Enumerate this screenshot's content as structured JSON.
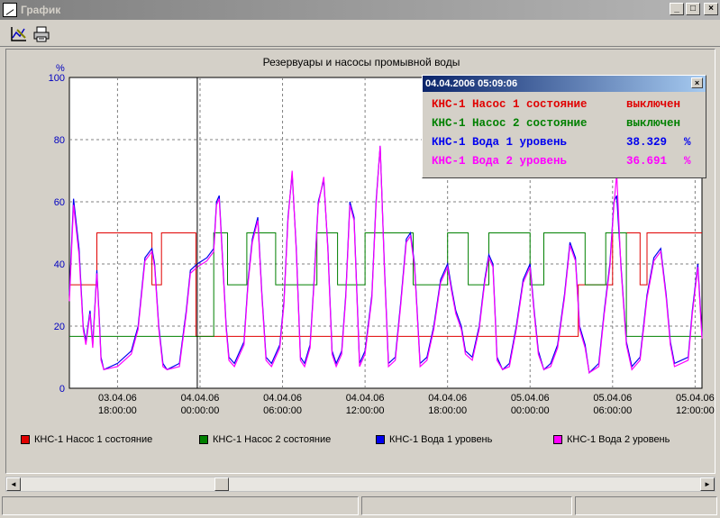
{
  "window": {
    "title": "График",
    "min": "_",
    "max": "□",
    "close": "×"
  },
  "toolbar": {
    "tools": [
      {
        "icon": "chart-tool-icon"
      },
      {
        "icon": "printer-icon"
      }
    ]
  },
  "chart_data": {
    "type": "line",
    "title": "Резервуары и насосы промывной воды",
    "ylabel": "%",
    "ylim": [
      0,
      100
    ],
    "yticks": [
      "0",
      "20",
      "40",
      "60",
      "80",
      "100"
    ],
    "xticks": [
      {
        "date": "03.04.06",
        "time": "18:00:00"
      },
      {
        "date": "04.04.06",
        "time": "00:00:00"
      },
      {
        "date": "04.04.06",
        "time": "06:00:00"
      },
      {
        "date": "04.04.06",
        "time": "12:00:00"
      },
      {
        "date": "04.04.06",
        "time": "18:00:00"
      },
      {
        "date": "05.04.06",
        "time": "00:00:00"
      },
      {
        "date": "05.04.06",
        "time": "06:00:00"
      },
      {
        "date": "05.04.06",
        "time": "12:00:00"
      }
    ],
    "xlim_hours": [
      -3.5,
      42.5
    ],
    "cursor_hour": 5.8,
    "grid": true,
    "series": [
      {
        "name": "КНС-1 Насос 1 состояние",
        "color": "#e00000",
        "step": true,
        "points": [
          [
            -3.5,
            33.3
          ],
          [
            -1.5,
            33.3
          ],
          [
            -1.5,
            50
          ],
          [
            2.5,
            50
          ],
          [
            2.5,
            33.3
          ],
          [
            3.2,
            33.3
          ],
          [
            3.2,
            50
          ],
          [
            5.7,
            50
          ],
          [
            5.7,
            16.7
          ],
          [
            7,
            16.7
          ],
          [
            7,
            16.7
          ],
          [
            33.5,
            16.7
          ],
          [
            33.5,
            33.3
          ],
          [
            36,
            33.3
          ],
          [
            36,
            50
          ],
          [
            38,
            50
          ],
          [
            38,
            33.3
          ],
          [
            38.5,
            33.3
          ],
          [
            38.5,
            50
          ],
          [
            42.5,
            50
          ]
        ]
      },
      {
        "name": "КНС-1 Насос 2 состояние",
        "color": "#008000",
        "step": true,
        "points": [
          [
            -3.5,
            16.7
          ],
          [
            7,
            16.7
          ],
          [
            7,
            50
          ],
          [
            8,
            50
          ],
          [
            8,
            33.3
          ],
          [
            9.4,
            33.3
          ],
          [
            9.4,
            50
          ],
          [
            11.5,
            50
          ],
          [
            11.5,
            33.3
          ],
          [
            14.5,
            33.3
          ],
          [
            14.5,
            50
          ],
          [
            16,
            50
          ],
          [
            16,
            33.3
          ],
          [
            18,
            33.3
          ],
          [
            18,
            50
          ],
          [
            21.5,
            50
          ],
          [
            21.5,
            33.3
          ],
          [
            24,
            33.3
          ],
          [
            24,
            50
          ],
          [
            25.5,
            50
          ],
          [
            25.5,
            33.3
          ],
          [
            27,
            33.3
          ],
          [
            27,
            50
          ],
          [
            30,
            50
          ],
          [
            30,
            33.3
          ],
          [
            31,
            33.3
          ],
          [
            31,
            50
          ],
          [
            34,
            50
          ],
          [
            34,
            33.3
          ],
          [
            35.5,
            33.3
          ],
          [
            35.5,
            50
          ],
          [
            37,
            50
          ],
          [
            37,
            16.7
          ],
          [
            42.5,
            16.7
          ]
        ]
      },
      {
        "name": "КНС-1 Вода 1 уровень",
        "color": "#0000ee",
        "points": [
          [
            -3.5,
            30
          ],
          [
            -3.2,
            61
          ],
          [
            -2.8,
            45
          ],
          [
            -2.5,
            20
          ],
          [
            -2.3,
            15
          ],
          [
            -2.0,
            25
          ],
          [
            -1.8,
            14
          ],
          [
            -1.6,
            30
          ],
          [
            -1.5,
            38
          ],
          [
            -1.3,
            20
          ],
          [
            -1.2,
            10
          ],
          [
            -1.0,
            6
          ],
          [
            0,
            8
          ],
          [
            1,
            12
          ],
          [
            1.5,
            20
          ],
          [
            2,
            42
          ],
          [
            2.5,
            45
          ],
          [
            2.7,
            40
          ],
          [
            3.0,
            20
          ],
          [
            3.3,
            8
          ],
          [
            3.6,
            6
          ],
          [
            4.5,
            8
          ],
          [
            5.0,
            25
          ],
          [
            5.3,
            38
          ],
          [
            5.8,
            40
          ],
          [
            6.5,
            42
          ],
          [
            7,
            45
          ],
          [
            7.2,
            60
          ],
          [
            7.4,
            62
          ],
          [
            7.6,
            45
          ],
          [
            7.9,
            20
          ],
          [
            8.1,
            10
          ],
          [
            8.5,
            8
          ],
          [
            9.2,
            15
          ],
          [
            9.5,
            35
          ],
          [
            9.8,
            48
          ],
          [
            10.2,
            55
          ],
          [
            10.5,
            30
          ],
          [
            10.8,
            10
          ],
          [
            11.2,
            8
          ],
          [
            11.8,
            14
          ],
          [
            12.1,
            28
          ],
          [
            12.4,
            55
          ],
          [
            12.7,
            69
          ],
          [
            13.0,
            45
          ],
          [
            13.3,
            10
          ],
          [
            13.6,
            8
          ],
          [
            14.0,
            14
          ],
          [
            14.3,
            35
          ],
          [
            14.6,
            60
          ],
          [
            15.0,
            67
          ],
          [
            15.3,
            45
          ],
          [
            15.6,
            12
          ],
          [
            15.9,
            8
          ],
          [
            16.3,
            12
          ],
          [
            16.6,
            30
          ],
          [
            16.9,
            60
          ],
          [
            17.2,
            55
          ],
          [
            17.6,
            8
          ],
          [
            18.0,
            12
          ],
          [
            18.5,
            30
          ],
          [
            18.8,
            60
          ],
          [
            19.1,
            78
          ],
          [
            19.4,
            40
          ],
          [
            19.7,
            8
          ],
          [
            20.2,
            10
          ],
          [
            20.6,
            28
          ],
          [
            21.0,
            48
          ],
          [
            21.3,
            50
          ],
          [
            21.6,
            40
          ],
          [
            22.0,
            8
          ],
          [
            22.5,
            10
          ],
          [
            23.0,
            20
          ],
          [
            23.5,
            35
          ],
          [
            24.0,
            40
          ],
          [
            24.3,
            32
          ],
          [
            24.6,
            25
          ],
          [
            25.0,
            20
          ],
          [
            25.3,
            12
          ],
          [
            25.8,
            10
          ],
          [
            26.3,
            20
          ],
          [
            26.7,
            35
          ],
          [
            27.0,
            43
          ],
          [
            27.3,
            40
          ],
          [
            27.6,
            10
          ],
          [
            28.0,
            6
          ],
          [
            28.5,
            8
          ],
          [
            29.0,
            20
          ],
          [
            29.5,
            35
          ],
          [
            30.0,
            40
          ],
          [
            30.3,
            25
          ],
          [
            30.6,
            12
          ],
          [
            31.0,
            6
          ],
          [
            31.5,
            8
          ],
          [
            32,
            14
          ],
          [
            32.5,
            30
          ],
          [
            32.9,
            47
          ],
          [
            33.3,
            42
          ],
          [
            33.6,
            20
          ],
          [
            34.0,
            14
          ],
          [
            34.3,
            5
          ],
          [
            35.0,
            8
          ],
          [
            35.4,
            25
          ],
          [
            35.8,
            40
          ],
          [
            36.1,
            60
          ],
          [
            36.3,
            62
          ],
          [
            36.6,
            40
          ],
          [
            37.0,
            15
          ],
          [
            37.4,
            7
          ],
          [
            38.0,
            10
          ],
          [
            38.5,
            30
          ],
          [
            39.0,
            42
          ],
          [
            39.5,
            45
          ],
          [
            39.9,
            30
          ],
          [
            40.2,
            15
          ],
          [
            40.5,
            8
          ],
          [
            41.5,
            10
          ],
          [
            41.8,
            25
          ],
          [
            42.2,
            40
          ],
          [
            42.5,
            17
          ]
        ]
      },
      {
        "name": "КНС-1 Вода 2 уровень",
        "color": "#ff00ff",
        "points": [
          [
            -3.5,
            28
          ],
          [
            -3.2,
            59
          ],
          [
            -2.8,
            43
          ],
          [
            -2.5,
            19
          ],
          [
            -2.3,
            14
          ],
          [
            -2.0,
            24
          ],
          [
            -1.8,
            13
          ],
          [
            -1.6,
            29
          ],
          [
            -1.5,
            37
          ],
          [
            -1.3,
            19
          ],
          [
            -1.2,
            9
          ],
          [
            -1.0,
            6
          ],
          [
            0,
            7
          ],
          [
            1,
            11
          ],
          [
            1.5,
            19
          ],
          [
            2,
            41
          ],
          [
            2.5,
            44
          ],
          [
            2.7,
            39
          ],
          [
            3.0,
            19
          ],
          [
            3.3,
            7
          ],
          [
            3.6,
            6
          ],
          [
            4.5,
            7
          ],
          [
            5.0,
            24
          ],
          [
            5.3,
            37
          ],
          [
            5.8,
            39
          ],
          [
            6.5,
            41
          ],
          [
            7,
            44
          ],
          [
            7.2,
            59
          ],
          [
            7.4,
            61
          ],
          [
            7.6,
            44
          ],
          [
            7.9,
            19
          ],
          [
            8.1,
            9
          ],
          [
            8.5,
            7
          ],
          [
            9.2,
            14
          ],
          [
            9.5,
            34
          ],
          [
            9.8,
            47
          ],
          [
            10.2,
            54
          ],
          [
            10.5,
            29
          ],
          [
            10.8,
            9
          ],
          [
            11.2,
            7
          ],
          [
            11.8,
            13
          ],
          [
            12.1,
            27
          ],
          [
            12.4,
            54
          ],
          [
            12.7,
            70
          ],
          [
            13.0,
            44
          ],
          [
            13.3,
            9
          ],
          [
            13.6,
            7
          ],
          [
            14.0,
            13
          ],
          [
            14.3,
            34
          ],
          [
            14.6,
            59
          ],
          [
            15.0,
            68
          ],
          [
            15.3,
            44
          ],
          [
            15.6,
            11
          ],
          [
            15.9,
            7
          ],
          [
            16.3,
            11
          ],
          [
            16.6,
            29
          ],
          [
            16.9,
            59
          ],
          [
            17.2,
            54
          ],
          [
            17.6,
            7
          ],
          [
            18.0,
            11
          ],
          [
            18.5,
            29
          ],
          [
            18.8,
            59
          ],
          [
            19.1,
            78
          ],
          [
            19.4,
            39
          ],
          [
            19.7,
            7
          ],
          [
            20.2,
            9
          ],
          [
            20.6,
            27
          ],
          [
            21.0,
            47
          ],
          [
            21.3,
            49
          ],
          [
            21.6,
            39
          ],
          [
            22.0,
            7
          ],
          [
            22.5,
            9
          ],
          [
            23.0,
            19
          ],
          [
            23.5,
            34
          ],
          [
            24.0,
            39
          ],
          [
            24.3,
            31
          ],
          [
            24.6,
            24
          ],
          [
            25.0,
            19
          ],
          [
            25.3,
            11
          ],
          [
            25.8,
            9
          ],
          [
            26.3,
            19
          ],
          [
            26.7,
            34
          ],
          [
            27.0,
            42
          ],
          [
            27.3,
            39
          ],
          [
            27.6,
            9
          ],
          [
            28.0,
            6
          ],
          [
            28.5,
            7
          ],
          [
            29.0,
            19
          ],
          [
            29.5,
            34
          ],
          [
            30.0,
            39
          ],
          [
            30.3,
            24
          ],
          [
            30.6,
            11
          ],
          [
            31.0,
            6
          ],
          [
            31.5,
            7
          ],
          [
            32,
            13
          ],
          [
            32.5,
            29
          ],
          [
            32.9,
            46
          ],
          [
            33.3,
            41
          ],
          [
            33.6,
            19
          ],
          [
            34.0,
            13
          ],
          [
            34.3,
            5
          ],
          [
            35.0,
            7
          ],
          [
            35.4,
            24
          ],
          [
            35.8,
            39
          ],
          [
            36.1,
            59
          ],
          [
            36.3,
            69
          ],
          [
            36.6,
            39
          ],
          [
            37.0,
            14
          ],
          [
            37.4,
            6
          ],
          [
            38.0,
            9
          ],
          [
            38.5,
            29
          ],
          [
            39.0,
            41
          ],
          [
            39.5,
            44
          ],
          [
            39.9,
            29
          ],
          [
            40.2,
            14
          ],
          [
            40.5,
            7
          ],
          [
            41.5,
            9
          ],
          [
            41.8,
            24
          ],
          [
            42.2,
            39
          ],
          [
            42.5,
            16
          ]
        ]
      }
    ]
  },
  "popup": {
    "title": "04.04.2006 05:09:06",
    "close": "×",
    "rows": [
      {
        "label": "КНС-1 Насос 1 состояние",
        "value": "выключен",
        "unit": "",
        "color": "#e00000"
      },
      {
        "label": "КНС-1 Насос 2 состояние",
        "value": "выключен",
        "unit": "",
        "color": "#008000"
      },
      {
        "label": "КНС-1 Вода 1 уровень",
        "value": "38.329",
        "unit": "%",
        "color": "#0000ee"
      },
      {
        "label": "КНС-1 Вода 2 уровень",
        "value": "36.691",
        "unit": "%",
        "color": "#ff00ff"
      }
    ]
  },
  "scrollbar": {
    "left": "◄",
    "right": "►",
    "position": 0.29
  }
}
